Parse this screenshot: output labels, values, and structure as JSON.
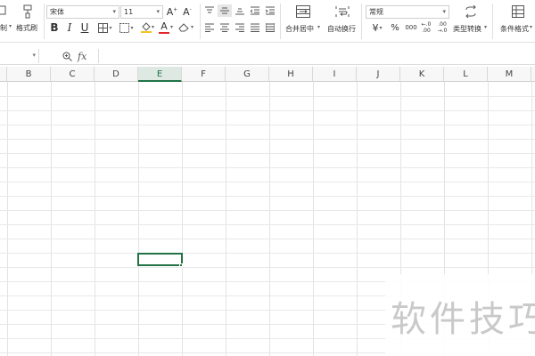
{
  "ribbon": {
    "partial_left_label": "制",
    "format_painter": "格式刷",
    "font_name": "宋体",
    "font_size": "11",
    "merge_center": "合并居中",
    "wrap_text": "自动换行",
    "number_format": "常规",
    "type_convert": "类型转换",
    "conditional_format": "条件格式",
    "icons": {
      "bold": "B",
      "italic": "I",
      "underline": "U",
      "grow_font": "A⁺",
      "shrink_font": "A⁻",
      "currency": "¥",
      "percent": "%",
      "thousands": "000",
      "inc_decimal": "←.0 .00",
      "dec_decimal": ".00 →.0",
      "font_color_letter": "A"
    },
    "accent_colors": {
      "fill": "#f5c518",
      "font": "#e0282e"
    }
  },
  "formula_bar": {
    "fx_label": "fx",
    "value": ""
  },
  "sheet": {
    "columns": [
      "B",
      "C",
      "D",
      "E",
      "F",
      "G",
      "H",
      "I",
      "J",
      "K",
      "L",
      "M"
    ],
    "active_column": "E"
  },
  "watermark": "软件技巧"
}
